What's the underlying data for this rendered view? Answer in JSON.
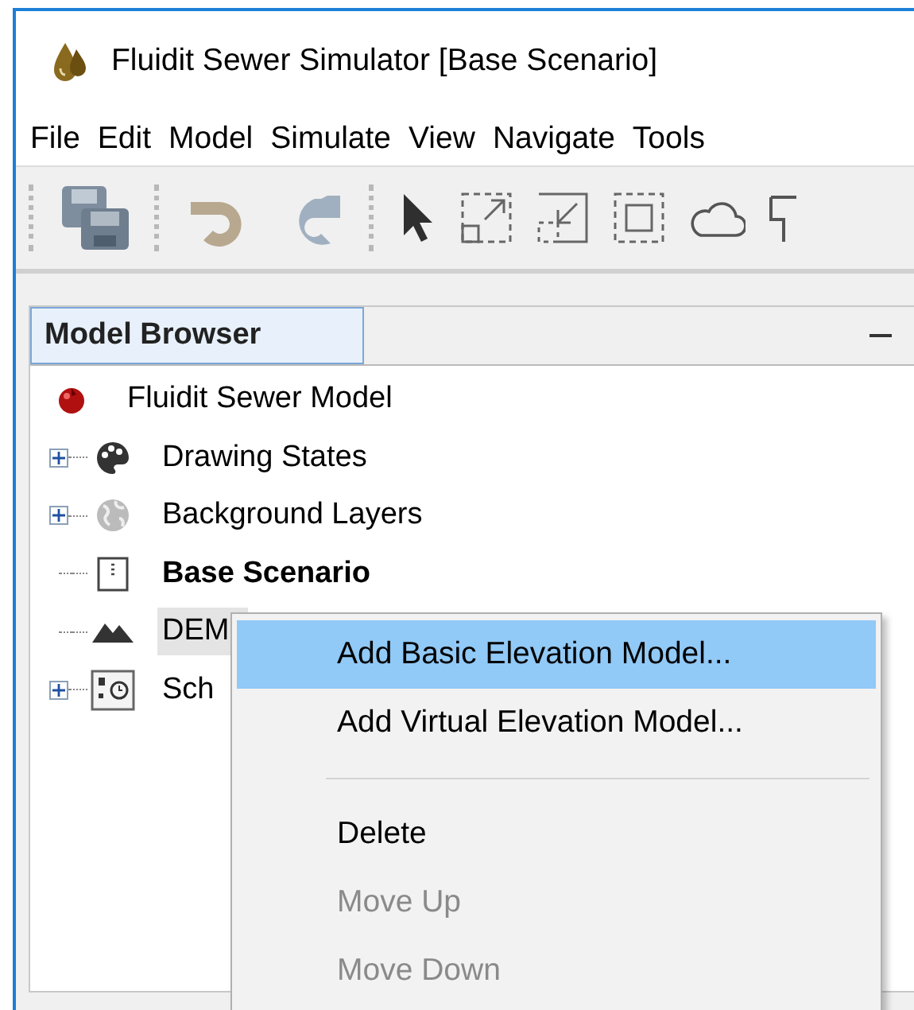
{
  "window": {
    "title": "Fluidit Sewer Simulator [Base Scenario]"
  },
  "menu_bar": [
    "File",
    "Edit",
    "Model",
    "Simulate",
    "View",
    "Navigate",
    "Tools"
  ],
  "panel": {
    "title": "Model Browser",
    "tree": [
      {
        "label": "Fluidit Sewer Model",
        "bold": false,
        "selected": false,
        "children": [
          {
            "label": "Drawing States",
            "bold": false,
            "selected": false,
            "expandable": true
          },
          {
            "label": "Background Layers",
            "bold": false,
            "selected": false,
            "expandable": true
          },
          {
            "label": "Base Scenario",
            "bold": true,
            "selected": false,
            "expandable": false
          },
          {
            "label": "DEM",
            "bold": false,
            "selected": true,
            "expandable": false
          },
          {
            "label": "Sch",
            "bold": false,
            "selected": false,
            "expandable": true
          }
        ]
      }
    ]
  },
  "context_menu": [
    {
      "kind": "item",
      "label": "Add Basic Elevation Model...",
      "selected": true,
      "disabled": false
    },
    {
      "kind": "item",
      "label": "Add Virtual Elevation Model...",
      "selected": false,
      "disabled": false
    },
    {
      "kind": "separator"
    },
    {
      "kind": "item",
      "label": "Delete",
      "selected": false,
      "disabled": false
    },
    {
      "kind": "item",
      "label": "Move Up",
      "selected": false,
      "disabled": true
    },
    {
      "kind": "item",
      "label": "Move Down",
      "selected": false,
      "disabled": true
    }
  ]
}
